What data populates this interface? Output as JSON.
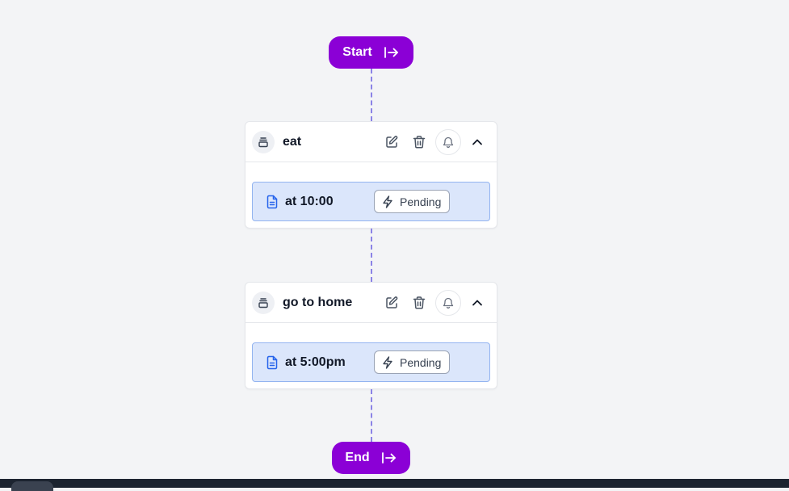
{
  "flow": {
    "start_label": "Start",
    "end_label": "End"
  },
  "tasks": [
    {
      "title": "eat",
      "detail": "at 10:00",
      "status": "Pending"
    },
    {
      "title": "go to home",
      "detail": "at 5:00pm",
      "status": "Pending"
    }
  ],
  "icons": {
    "start": "arrow-right-to-bar-icon",
    "end": "arrow-right-to-bar-icon",
    "task_type": "stack-icon",
    "edit": "pencil-square-icon",
    "delete": "trash-icon",
    "notify": "bell-icon",
    "collapse": "chevron-up-icon",
    "detail": "document-icon",
    "status": "lightning-icon"
  },
  "colors": {
    "background": "#f3f4f6",
    "pill": "#8b00d6",
    "connector": "#8b83e6",
    "detail_bg": "#dbe6fb",
    "detail_border": "#93b4f0",
    "detail_icon": "#2563eb"
  }
}
